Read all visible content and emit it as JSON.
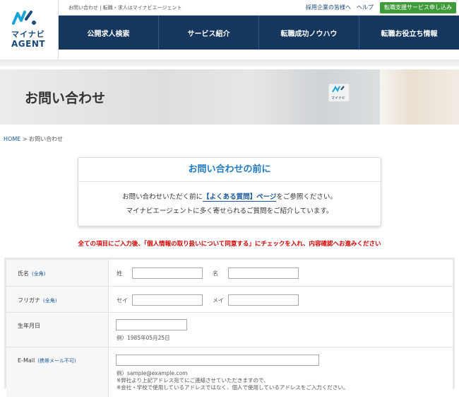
{
  "header": {
    "logo_kana": "マイナビ",
    "logo_en": "AGENT",
    "tagline": "お問い合わせ | 転職・求人はマイナビエージェント",
    "links": [
      "採用企業の皆様へ",
      "ヘルプ"
    ],
    "cta": "転職支援サービス申し込み",
    "nav": [
      "公開求人検索",
      "サービス紹介",
      "転職成功ノウハウ",
      "転職お役立ち情報"
    ]
  },
  "hero": {
    "title": "お問い合わせ",
    "sign_text": "マイナビ"
  },
  "breadcrumb": {
    "home": "HOME",
    "separator": " > ",
    "current": "お問い合わせ"
  },
  "notice": {
    "title": "お問い合わせの前に",
    "line1_pre": "お問い合わせいただく前に",
    "line1_link": "【よくある質問】ページ",
    "line1_post": "をご参照ください。",
    "line2": "マイナビエージェントに多く寄せられるご質問をご紹介しています。"
  },
  "instruction": "全ての項目にご入力後、「個人情報の取り扱いについて同意する」にチェックを入れ、内容確認へお進みください",
  "form": {
    "name": {
      "label": "氏名",
      "req": "(全角)",
      "sub1": "姓",
      "sub2": "名",
      "value1": "",
      "value2": ""
    },
    "kana": {
      "label": "フリガナ",
      "req": "(全角)",
      "sub1": "セイ",
      "sub2": "メイ",
      "value1": "",
      "value2": ""
    },
    "birth": {
      "label": "生年月日",
      "value": "",
      "hint": "例）1985年05月25日"
    },
    "email": {
      "label": "E-Mail",
      "req": "(携帯メール不可)",
      "value": "",
      "hint1": "例）sample@example.com",
      "hint2": "※弊社より上記アドレス宛てにご連絡させていただきますので、",
      "hint3": "※会社・学校で使用しているアドレスではなく、個人で使用しているアドレスをご入力ください。"
    }
  },
  "colors": {
    "nav_bg": "#15375e",
    "cta_bg": "#3f9a3a",
    "accent_blue": "#1f7ac0",
    "warning_red": "#d40000"
  }
}
